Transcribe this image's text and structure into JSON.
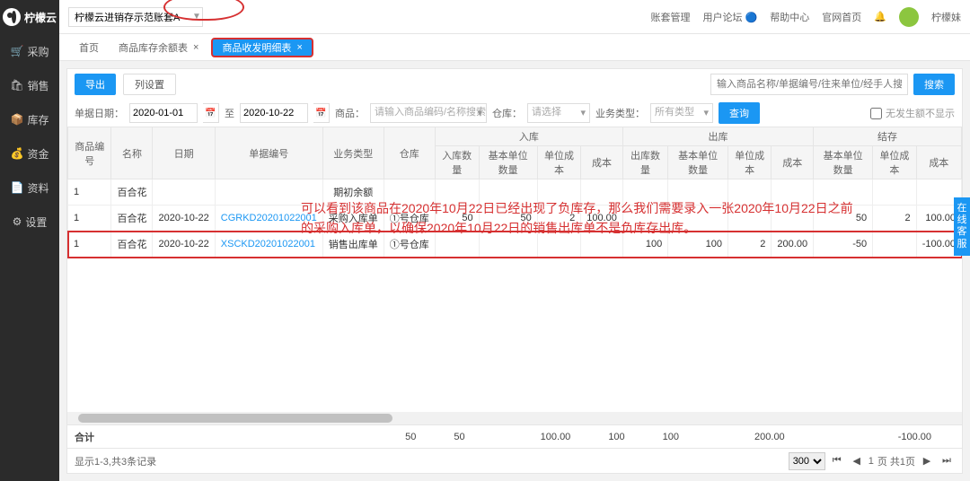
{
  "brand": "柠檬云",
  "account": "柠檬云进销存示范账套A",
  "topLinks": {
    "acct": "账套管理",
    "forum": "用户论坛",
    "help": "帮助中心",
    "home": "官网首页",
    "user": "柠檬妹"
  },
  "side": {
    "items": [
      "采购",
      "销售",
      "库存",
      "资金",
      "资料",
      "设置"
    ],
    "icons": [
      "🛒",
      "🛍",
      "📦",
      "💰",
      "📄",
      "⚙"
    ]
  },
  "tabs": {
    "home": "首页",
    "t1": "商品库存余额表",
    "t2": "商品收发明细表"
  },
  "toolbar": {
    "export": "导出",
    "cols": "列设置",
    "search_ph": "输入商品名称/单据编号/往来单位/经手人搜索",
    "search_btn": "搜索"
  },
  "filters": {
    "date_lbl": "单据日期：",
    "d1": "2020-01-01",
    "to": "至",
    "d2": "2020-10-22",
    "prod_lbl": "商品：",
    "prod_ph": "请输入商品编码/名称搜索",
    "wh_lbl": "仓库：",
    "wh_ph": "请选择",
    "biz_lbl": "业务类型：",
    "biz_ph": "所有类型",
    "query": "查询",
    "chk": "无发生额不显示"
  },
  "thead": {
    "c1": "商品编号",
    "c2": "名称",
    "c3": "日期",
    "c4": "单据编号",
    "c5": "业务类型",
    "c6": "仓库",
    "in": "入库",
    "out": "出库",
    "stk": "结存",
    "qty": "入库数量",
    "bqty": "基本单位数量",
    "ucost": "单位成本",
    "cost": "成本",
    "oqty": "出库数量"
  },
  "rows": [
    {
      "no": "1",
      "name": "百合花",
      "date": "",
      "doc": "",
      "biz": "期初余额",
      "wh": "",
      "iq": "",
      "ibq": "",
      "iuc": "",
      "ic": "",
      "oq": "",
      "obq": "",
      "ouc": "",
      "oc": "",
      "sq": "",
      "suc": "",
      "sc": ""
    },
    {
      "no": "1",
      "name": "百合花",
      "date": "2020-10-22",
      "doc": "CGRKD20201022001",
      "biz": "采购入库单",
      "wh": "①号仓库",
      "iq": "50",
      "ibq": "50",
      "iuc": "2",
      "ic": "100.00",
      "oq": "",
      "obq": "",
      "ouc": "",
      "oc": "",
      "sq": "50",
      "suc": "2",
      "sc": "100.00"
    },
    {
      "no": "1",
      "name": "百合花",
      "date": "2020-10-22",
      "doc": "XSCKD20201022001",
      "biz": "销售出库单",
      "wh": "①号仓库",
      "iq": "",
      "ibq": "",
      "iuc": "",
      "ic": "",
      "oq": "100",
      "obq": "100",
      "ouc": "2",
      "oc": "200.00",
      "sq": "-50",
      "suc": "",
      "sc": "-100.00"
    }
  ],
  "sum": {
    "lbl": "合计",
    "iq": "50",
    "ibq": "50",
    "ic": "100.00",
    "oq": "100",
    "obq": "100",
    "oc": "200.00",
    "sc": "-100.00"
  },
  "pager": {
    "info": "显示1-3,共3条记录",
    "size": "300",
    "page": "1",
    "sep": "页  共1页"
  },
  "anno": "可以看到该商品在2020年10月22日已经出现了负库存，那么我们需要录入一张2020年10月22日之前的采购入库单，以确保2020年10月22日的销售出库单不是负库存出库。",
  "helpFloat": "在线客服"
}
